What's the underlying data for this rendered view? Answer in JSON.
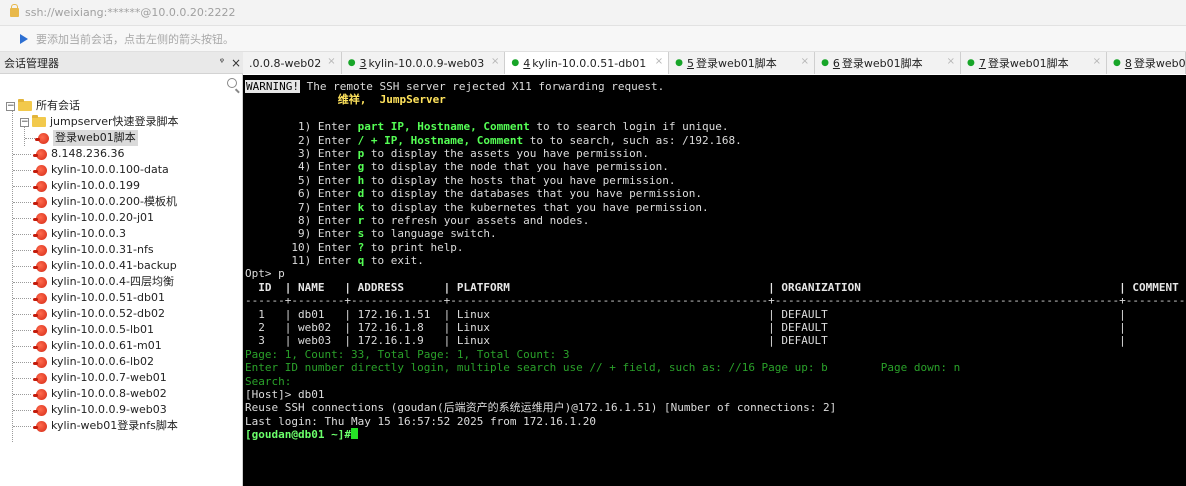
{
  "address_bar": {
    "text": "ssh://weixiang:******@10.0.0.20:2222"
  },
  "hint_bar": {
    "text": "要添加当前会话，点击左侧的箭头按钮。"
  },
  "session_manager": {
    "title": "会话管理器",
    "pin_glyph": "ᵠ",
    "close_glyph": "×",
    "root": "所有会话",
    "folder": "jumpserver快速登录脚本",
    "folder_child": "登录web01脚本",
    "sessions": [
      "8.148.236.36",
      "kylin-10.0.0.100-data",
      "kylin-10.0.0.199",
      "kylin-10.0.0.200-模板机",
      "kylin-10.0.0.20-j01",
      "kylin-10.0.0.3",
      "kylin-10.0.0.31-nfs",
      "kylin-10.0.0.41-backup",
      "kylin-10.0.0.4-四层均衡",
      "kylin-10.0.0.51-db01",
      "kylin-10.0.0.52-db02",
      "kylin-10.0.0.5-lb01",
      "kylin-10.0.0.61-m01",
      "kylin-10.0.0.6-lb02",
      "kylin-10.0.0.7-web01",
      "kylin-10.0.0.8-web02",
      "kylin-10.0.0.9-web03",
      "kylin-web01登录nfs脚本"
    ]
  },
  "tabs": [
    {
      "num": "",
      "label": ".0.0.8-web02",
      "dot": false
    },
    {
      "num": "3",
      "label": " kylin-10.0.0.9-web03",
      "dot": true
    },
    {
      "num": "4",
      "label": " kylin-10.0.0.51-db01",
      "dot": true
    },
    {
      "num": "5",
      "label": " 登录web01脚本",
      "dot": true
    },
    {
      "num": "6",
      "label": " 登录web01脚本",
      "dot": true
    },
    {
      "num": "7",
      "label": " 登录web01脚本",
      "dot": true
    },
    {
      "num": "8",
      "label": " 登录web0",
      "dot": true
    }
  ],
  "terminal": {
    "warning_tag": "WARNING!",
    "warning_text": " The remote SSH server rejected X11 forwarding request.",
    "greeting": "              维祥,  JumpServer",
    "menu": [
      {
        "pre": "        1) Enter ",
        "hl": "part IP, Hostname, Comment",
        "post": " to to search login if unique."
      },
      {
        "pre": "        2) Enter ",
        "hl": "/ + IP, Hostname, Comment",
        "post": " to to search, such as: /192.168."
      },
      {
        "pre": "        3) Enter ",
        "hl": "p",
        "post": " to display the assets you have permission."
      },
      {
        "pre": "        4) Enter ",
        "hl": "g",
        "post": " to display the node that you have permission."
      },
      {
        "pre": "        5) Enter ",
        "hl": "h",
        "post": " to display the hosts that you have permission."
      },
      {
        "pre": "        6) Enter ",
        "hl": "d",
        "post": " to display the databases that you have permission."
      },
      {
        "pre": "        7) Enter ",
        "hl": "k",
        "post": " to display the kubernetes that you have permission."
      },
      {
        "pre": "        8) Enter ",
        "hl": "r",
        "post": " to refresh your assets and nodes."
      },
      {
        "pre": "        9) Enter ",
        "hl": "s",
        "post": " to language switch."
      },
      {
        "pre": "       10) Enter ",
        "hl": "?",
        "post": " to print help."
      },
      {
        "pre": "       11) Enter ",
        "hl": "q",
        "post": " to exit."
      }
    ],
    "prompt_opt": "Opt> p",
    "table_header": "  ID  | NAME   | ADDRESS      | PLATFORM                                       | ORGANIZATION                                       | COMMENT",
    "table_sep": "------+--------+--------------+------------------------------------------------+----------------------------------------------------+----------",
    "table_rows": [
      "  1   | db01   | 172.16.1.51  | Linux                                          | DEFAULT                                            |",
      "  2   | web02  | 172.16.1.8   | Linux                                          | DEFAULT                                            |",
      "  3   | web03  | 172.16.1.9   | Linux                                          | DEFAULT                                            |"
    ],
    "page_line": "Page: 1, Count: 33, Total Page: 1, Total Count: 3",
    "enter_line": "Enter ID number directly login, multiple search use // + field, such as: //16 Page up: b        Page down: n",
    "search_line": "Search:",
    "host_prompt": "[Host]> db01",
    "reuse_line": "Reuse SSH connections (goudan(后端资产的系统运维用户)@172.16.1.51) [Number of connections: 2]",
    "last_login": "Last login: Thu May 15 16:57:52 2025 from 172.16.1.20",
    "shell_prompt": "[goudan@db01 ~]#"
  }
}
